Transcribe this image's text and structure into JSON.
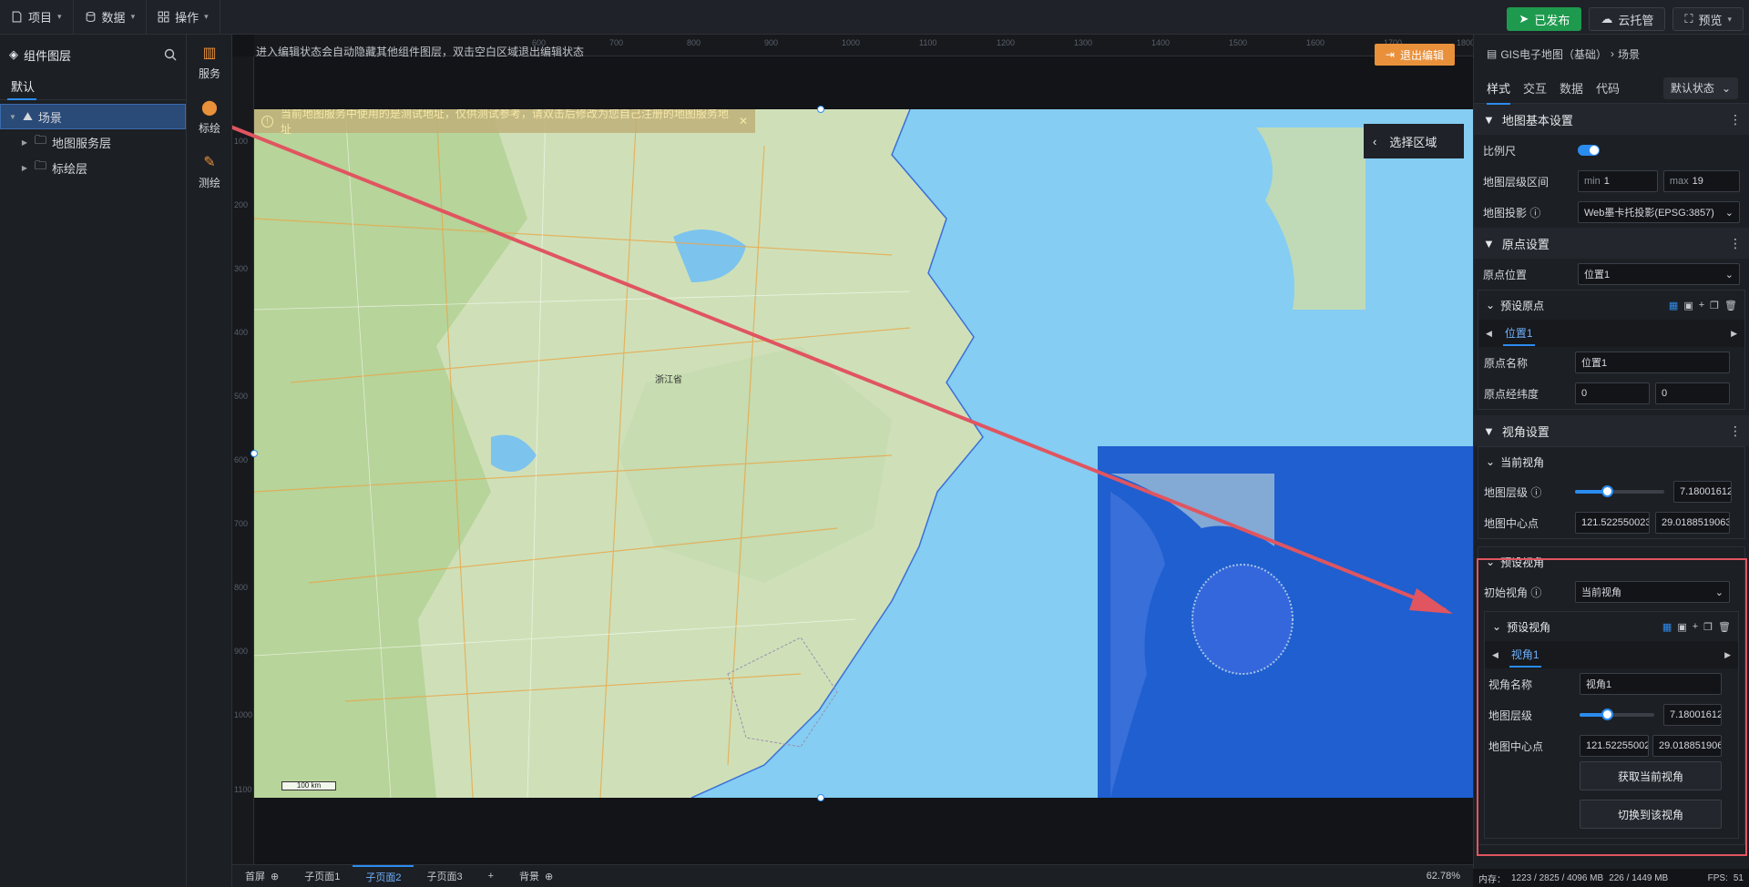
{
  "topbar": {
    "menus": [
      "项目",
      "数据",
      "操作"
    ],
    "published": "已发布",
    "cloud": "云托管",
    "preview": "预览"
  },
  "layers": {
    "title": "组件图层",
    "tab": "默认",
    "items": [
      "场景",
      "地图服务层",
      "标绘层"
    ]
  },
  "tools": [
    "服务",
    "标绘",
    "测绘"
  ],
  "canvas": {
    "edit_tip": "进入编辑状态会自动隐藏其他组件图层，双击空白区域退出编辑状态",
    "exit_edit": "退出编辑",
    "ruler_top": [
      "600",
      "700",
      "800",
      "900",
      "1000",
      "1100",
      "1200",
      "1300",
      "1400",
      "1500",
      "1600",
      "1700",
      "1800"
    ],
    "ruler_left": [
      "100",
      "200",
      "300",
      "400",
      "500",
      "600",
      "700",
      "800",
      "900",
      "1000",
      "1100"
    ],
    "warning": "当前地图服务中使用的是测试地址，仅供测试参考，请双击后修改为您自己注册的地图服务地址",
    "select_area": "选择区域",
    "scale": "100 km",
    "province": "浙江省"
  },
  "bottom": {
    "tabs": [
      "首屏",
      "子页面1",
      "子页面2",
      "子页面3",
      "背景"
    ],
    "active": 2,
    "zoom": "62.78%"
  },
  "panel": {
    "breadcrumb": [
      "GIS电子地图（基础）",
      "场景"
    ],
    "tabs": [
      "样式",
      "交互",
      "数据",
      "代码"
    ],
    "state": "默认状态",
    "map_basic": {
      "title": "地图基本设置",
      "scale_label": "比例尺",
      "scale_on": true,
      "zoom_range_label": "地图层级区间",
      "min_label": "min",
      "min": "1",
      "max_label": "max",
      "max": "19",
      "projection_label": "地图投影",
      "projection": "Web墨卡托投影(EPSG:3857)"
    },
    "origin": {
      "title": "原点设置",
      "pos_label": "原点位置",
      "pos": "位置1",
      "preset_title": "预设原点",
      "tab": "位置1",
      "name_label": "原点名称",
      "name": "位置1",
      "lnglat_label": "原点经纬度",
      "lng": "0",
      "lat": "0"
    },
    "view": {
      "title": "视角设置",
      "current_title": "当前视角",
      "zoom_label": "地图层级",
      "zoom": "7.180016129",
      "zoom_fraction": 0.36,
      "center_label": "地图中心点",
      "center_lng": "121.5225500236",
      "center_lat": "29.0188519063(",
      "preset_title": "预设视角",
      "init_label": "初始视角",
      "init_value": "当前视角",
      "preset_list_title": "预设视角",
      "preset_tab": "视角1",
      "name_label": "视角名称",
      "name": "视角1",
      "p_zoom_label": "地图层级",
      "p_zoom": "7.180016129",
      "p_center_label": "地图中心点",
      "p_lng": "121.522550023",
      "p_lat": "29.018851906",
      "get_btn": "获取当前视角",
      "switch_btn": "切换到该视角"
    },
    "status": {
      "mem_label": "内存：",
      "mem": "1223 / 2825 / 4096 MB",
      "extra": "226 / 1449 MB",
      "fps_label": "FPS:",
      "fps": "51"
    }
  },
  "colors": {
    "accent": "#2b8cf0",
    "published": "#1e9a4e",
    "exit": "#e9903a",
    "arrow": "#e05560"
  }
}
